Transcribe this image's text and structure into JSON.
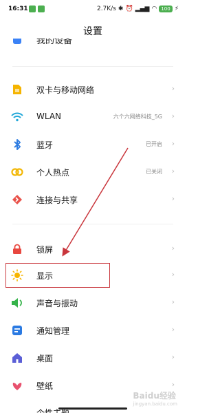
{
  "status_bar": {
    "time": "16:31",
    "speed": "2.7K/s",
    "battery": "100",
    "accent": "#4caf50"
  },
  "header": {
    "title": "设置"
  },
  "partial_top": {
    "label": "我的设备"
  },
  "settings": [
    {
      "label": "双卡与移动网络",
      "value": "",
      "icon": "sim-card-icon",
      "color": "#f5b400"
    },
    {
      "label": "WLAN",
      "value": "六个六网络科技_5G",
      "icon": "wifi-icon",
      "color": "#21a7d8"
    },
    {
      "label": "蓝牙",
      "value": "已开启",
      "icon": "bluetooth-icon",
      "color": "#2f7de1"
    },
    {
      "label": "个人热点",
      "value": "已关闭",
      "icon": "hotspot-icon",
      "color": "#f2b705"
    },
    {
      "label": "连接与共享",
      "value": "",
      "icon": "connection-share-icon",
      "color": "#e9524a"
    },
    {
      "label": "锁屏",
      "value": "",
      "icon": "lock-icon",
      "color": "#e8473f"
    },
    {
      "label": "显示",
      "value": "",
      "icon": "sun-icon",
      "color": "#f7b500"
    },
    {
      "label": "声音与振动",
      "value": "",
      "icon": "speaker-icon",
      "color": "#35b34a"
    },
    {
      "label": "通知管理",
      "value": "",
      "icon": "notification-icon",
      "color": "#2a7ae2"
    },
    {
      "label": "桌面",
      "value": "",
      "icon": "home-icon",
      "color": "#5b5fd6"
    },
    {
      "label": "壁纸",
      "value": "",
      "icon": "wallpaper-icon",
      "color": "#e8516e"
    }
  ],
  "partial_bottom": {
    "label": "个性主题"
  },
  "chevron": "›",
  "watermark": {
    "text": "Baidu经验",
    "sub": "jingyan.baidu.com"
  },
  "annotation_color": "#c9363c"
}
